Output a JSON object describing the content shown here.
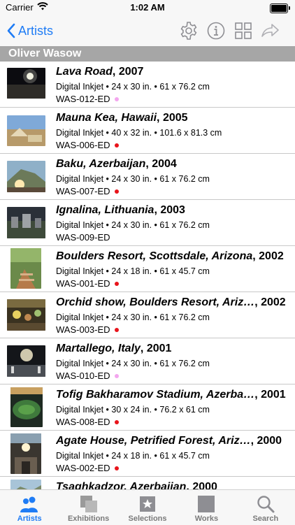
{
  "status_bar": {
    "carrier": "Carrier",
    "time": "1:02 AM"
  },
  "nav": {
    "back_label": "Artists"
  },
  "section_header": "Oliver Wasow",
  "works": [
    {
      "title": "Lava Road",
      "year": ", 2007",
      "detail": "Digital Inkjet • 24 x 30 in. •  61 x 76.2 cm",
      "code": "WAS-012-ED",
      "dot": "#f3a6ee"
    },
    {
      "title": "Mauna Kea, Hawaii",
      "year": ", 2005",
      "detail": "Digital Inkjet • 40 x 32 in. •  101.6 x 81.3 cm",
      "code": "WAS-006-ED",
      "dot": "#e8141b"
    },
    {
      "title": "Baku, Azerbaijan",
      "year": ", 2004",
      "detail": "Digital Inkjet • 24 x 30 in. •  61 x 76.2 cm",
      "code": "WAS-007-ED",
      "dot": "#e8141b"
    },
    {
      "title": "Ignalina, Lithuania",
      "year": ", 2003",
      "detail": "Digital Inkjet • 24 x 30 in. •  61 x 76.2 cm",
      "code": "WAS-009-ED",
      "dot": ""
    },
    {
      "title": "Boulders Resort, Scottsdale, Arizona",
      "year": ", 2002",
      "detail": "Digital Inkjet • 24 x 18 in. •  61 x 45.7 cm",
      "code": "WAS-001-ED",
      "dot": "#e8141b"
    },
    {
      "title": "Orchid show, Boulders Resort, Ariz…",
      "year": ", 2002",
      "detail": "Digital Inkjet • 24 x 30 in. •  61 x 76.2 cm",
      "code": "WAS-003-ED",
      "dot": "#e8141b"
    },
    {
      "title": "Martallego, Italy",
      "year": ", 2001",
      "detail": "Digital Inkjet • 24 x 30 in. •  61 x 76.2 cm",
      "code": "WAS-010-ED",
      "dot": "#f3a6ee"
    },
    {
      "title": "Tofig Bakharamov Stadium, Azerba…",
      "year": ", 2001",
      "detail": "Digital Inkjet • 30 x 24 in. •  76.2 x 61 cm",
      "code": "WAS-008-ED",
      "dot": "#e8141b"
    },
    {
      "title": "Agate House, Petrified Forest, Ariz…",
      "year": ", 2000",
      "detail": "Digital Inkjet • 24 x 18 in. •  61 x 45.7 cm",
      "code": "WAS-002-ED",
      "dot": "#e8141b"
    },
    {
      "title": "Tsaghkadzor, Azerbaijan",
      "year": ", 2000",
      "detail": "",
      "code": "",
      "dot": ""
    }
  ],
  "tabs": [
    {
      "label": "Artists",
      "icon": "artists-icon",
      "active": true
    },
    {
      "label": "Exhibitions",
      "icon": "exhibitions-icon",
      "active": false
    },
    {
      "label": "Selections",
      "icon": "selections-icon",
      "active": false
    },
    {
      "label": "Works",
      "icon": "works-icon",
      "active": false
    },
    {
      "label": "Search",
      "icon": "search-icon",
      "active": false
    }
  ],
  "colors": {
    "accent": "#1f7cf5",
    "icon_gray": "#8e8e93",
    "section_bg": "#a6a6a6",
    "red_dot": "#e8141b",
    "pink_dot": "#f3a6ee"
  }
}
